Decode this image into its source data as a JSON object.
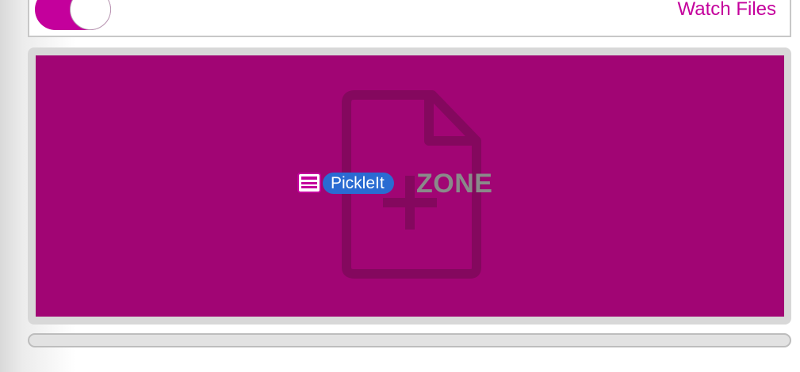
{
  "toggle": {
    "on": true,
    "accent": "#c4009c"
  },
  "header": {
    "watch_files_label": "Watch Files"
  },
  "drop_zone": {
    "label_visible": "ZONE",
    "background": "#a10574",
    "icon": "file-plus-icon"
  },
  "overlay": {
    "app_icon": "picklelt-app-icon",
    "app_label": "PickleIt",
    "badge_color": "#2a6bd2"
  },
  "progress": {
    "value": 0
  }
}
